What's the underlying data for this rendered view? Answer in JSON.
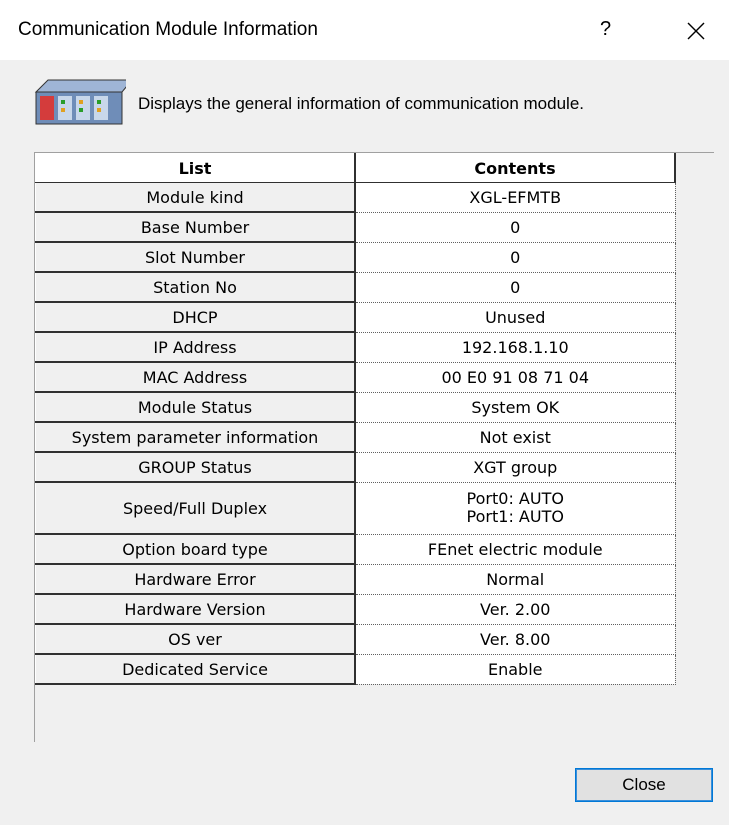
{
  "window": {
    "title": "Communication Module Information",
    "help_label": "?",
    "close_glyph": "×"
  },
  "header": {
    "icon": "plc-module-icon",
    "description": "Displays the general information of communication module."
  },
  "table": {
    "columns": [
      "List",
      "Contents"
    ],
    "rows": [
      {
        "label": "Module kind",
        "value": "XGL-EFMTB"
      },
      {
        "label": "Base Number",
        "value": "0"
      },
      {
        "label": "Slot Number",
        "value": "0"
      },
      {
        "label": "Station No",
        "value": "0"
      },
      {
        "label": "DHCP",
        "value": "Unused"
      },
      {
        "label": "IP Address",
        "value": "192.168.1.10"
      },
      {
        "label": "MAC Address",
        "value": "00 E0 91 08 71 04"
      },
      {
        "label": "Module Status",
        "value": "System OK"
      },
      {
        "label": "System parameter information",
        "value": "Not exist"
      },
      {
        "label": "GROUP Status",
        "value": "XGT group"
      },
      {
        "label": "Speed/Full Duplex",
        "value": "Port0: AUTO",
        "value2": "Port1: AUTO"
      },
      {
        "label": "Option board type",
        "value": "FEnet electric module"
      },
      {
        "label": "Hardware Error",
        "value": "Normal"
      },
      {
        "label": "Hardware Version",
        "value": "Ver. 2.00"
      },
      {
        "label": "OS ver",
        "value": "Ver. 8.00"
      },
      {
        "label": "Dedicated Service",
        "value": "Enable"
      }
    ]
  },
  "footer": {
    "close_label": "Close"
  }
}
